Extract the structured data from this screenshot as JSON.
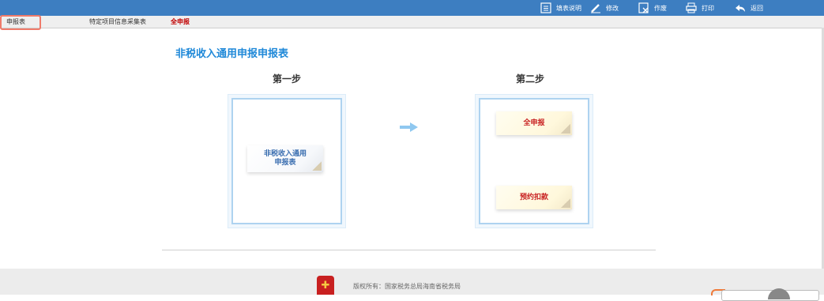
{
  "toolbar": {
    "items": [
      {
        "icon": "document-icon",
        "label": "填表说明"
      },
      {
        "icon": "pencil-icon",
        "label": "修改"
      },
      {
        "icon": "void-document-icon",
        "label": "作废"
      },
      {
        "icon": "printer-icon",
        "label": "打印"
      },
      {
        "icon": "back-arrow-icon",
        "label": "返回"
      }
    ]
  },
  "tabs": [
    {
      "label": "申报表",
      "active": false
    },
    {
      "label": "特定项目信息采集表",
      "active": false
    },
    {
      "label": "全申报",
      "active": true
    }
  ],
  "main": {
    "title": "非税收入通用申报申报表",
    "step1": {
      "label": "第一步",
      "card": "非税收入通用申报表"
    },
    "step2": {
      "label": "第二步",
      "card1": "全申报",
      "card2": "预约扣款"
    }
  },
  "footer": {
    "copyright": "版权所有：国家税务总局海南省税务局"
  },
  "colors": {
    "topbar": "#3d7ec1",
    "title": "#1e88d8",
    "active_tab": "#c00000",
    "highlight": "#ef7a6a"
  }
}
